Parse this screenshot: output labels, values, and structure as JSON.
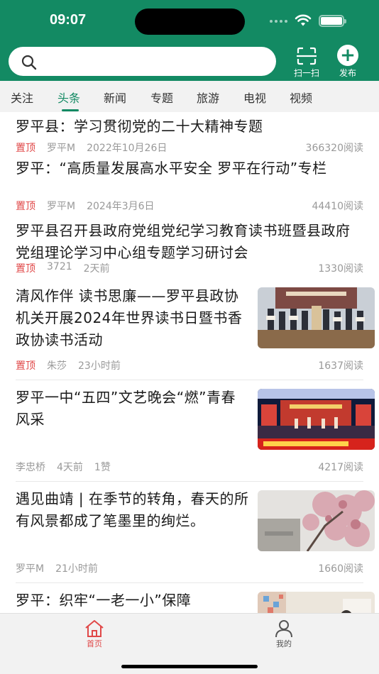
{
  "status_bar": {
    "time": "09:07"
  },
  "header": {
    "search_placeholder": "",
    "scan_label": "扫一扫",
    "publish_label": "发布",
    "brand_color": "#138a63"
  },
  "tabs": [
    {
      "label": "关注",
      "active": false
    },
    {
      "label": "头条",
      "active": true
    },
    {
      "label": "新闻",
      "active": false
    },
    {
      "label": "专题",
      "active": false
    },
    {
      "label": "旅游",
      "active": false
    },
    {
      "label": "电视",
      "active": false
    },
    {
      "label": "视频",
      "active": false
    }
  ],
  "feed": [
    {
      "title": "罗平县：学习贯彻党的二十大精神专题",
      "pin": "置顶",
      "author": "罗平M",
      "time": "2022年10月26日",
      "extra": "",
      "reads": "366320阅读"
    },
    {
      "title": "罗平：“高质量发展高水平安全 罗平在行动”专栏",
      "pin": "置顶",
      "author": "罗平M",
      "time": "2024年3月6日",
      "extra": "",
      "reads": "44410阅读"
    },
    {
      "title": "罗平县召开县政府党组党纪学习教育读书班暨县政府党组理论学习中心组专题学习研讨会",
      "pin": "置顶",
      "author": "3721",
      "time": "2天前",
      "extra": "",
      "reads": "1330阅读"
    },
    {
      "title": "清风作伴 读书思廉——罗平县政协机关开展2024年世界读书日暨书香政协读书活动",
      "pin": "置顶",
      "author": "朱莎",
      "time": "23小时前",
      "extra": "",
      "reads": "1637阅读",
      "thumb": "reading-event-photo"
    },
    {
      "title": "罗平一中“五四”文艺晚会“燃”青春风采",
      "pin": "",
      "author": "李忠桥",
      "time": "4天前",
      "extra": "1赞",
      "reads": "4217阅读",
      "thumb": "stage-performance-photo"
    },
    {
      "title": "遇见曲靖 | 在季节的转角，春天的所有风景都成了笔墨里的绚烂。",
      "pin": "",
      "author": "罗平M",
      "time": "21小时前",
      "extra": "",
      "reads": "1660阅读",
      "thumb": "blossom-tree-photo"
    },
    {
      "title": "罗平：织牢“一老一小”保障",
      "pin": "",
      "author": "",
      "time": "",
      "extra": "",
      "reads": "",
      "thumb": "classroom-photo"
    }
  ],
  "bottom_nav": [
    {
      "label": "首页",
      "icon": "home-icon",
      "active": true
    },
    {
      "label": "我的",
      "icon": "user-icon",
      "active": false
    }
  ],
  "colors": {
    "pin": "#e04848",
    "meta": "#999999",
    "active_nav": "#e04848"
  }
}
